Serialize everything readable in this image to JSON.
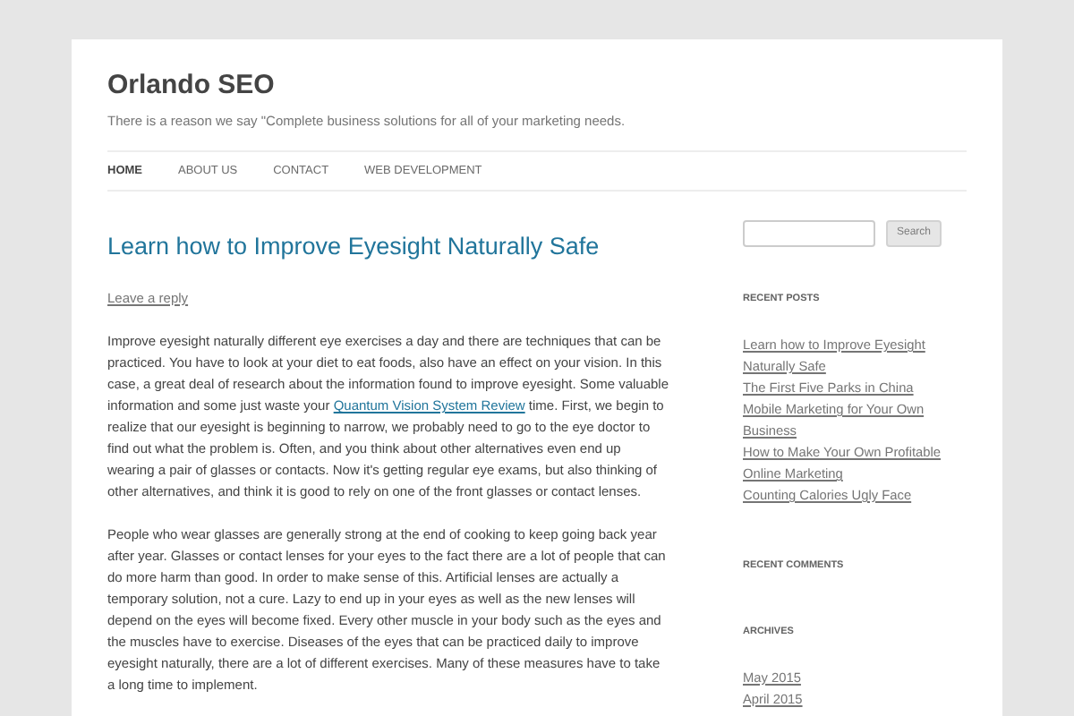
{
  "site": {
    "title": "Orlando SEO",
    "tagline": "There is a reason we say \"Complete business solutions for all of your marketing needs."
  },
  "nav": [
    {
      "label": "HOME",
      "selected": true
    },
    {
      "label": "ABOUT US",
      "selected": false
    },
    {
      "label": "CONTACT",
      "selected": false
    },
    {
      "label": "WEB DEVELOPMENT",
      "selected": false
    }
  ],
  "post": {
    "title": "Learn how to Improve Eyesight Naturally Safe",
    "reply_link": "Leave a reply",
    "paragraphs": [
      {
        "before": "Improve eyesight naturally different eye exercises a day and there are techniques that can be practiced. You have to look at your diet to eat foods, also have an effect on your vision. In this case, a great deal of research about the information found to improve eyesight. Some valuable information and some just waste your",
        "link": "Quantum Vision System Review",
        "after": "time. First, we begin to realize that our eyesight is beginning to narrow, we probably need to go to the eye doctor to find out what the problem is. Often, and you think about other alternatives even end up wearing a pair of glasses or contacts. Now it's getting regular eye exams, but also thinking of other alternatives, and think it is good to rely on one of the front glasses or contact lenses."
      },
      {
        "before": "People who wear glasses are generally strong at the end of cooking to keep going back year after year. Glasses or contact lenses for your eyes to the fact there are a lot of people that can do more harm than good. In order to make sense of this. Artificial lenses are actually a temporary solution, not a cure. Lazy to end up in your eyes as well as the new lenses will depend on the eyes will become fixed. Every other muscle in your body such as the eyes and the muscles have to exercise. Diseases of the eyes that can be practiced daily to improve eyesight naturally, there are a lot of different exercises. Many of these measures have to take a long time to implement."
      }
    ]
  },
  "sidebar": {
    "search_button": "Search",
    "widgets": [
      {
        "heading": "RECENT POSTS",
        "links": [
          "Learn how to Improve Eyesight Naturally Safe",
          "The First Five Parks in China",
          "Mobile Marketing for Your Own Business",
          "How to Make Your Own Profitable Online Marketing",
          "Counting Calories Ugly Face"
        ]
      },
      {
        "heading": "RECENT COMMENTS"
      },
      {
        "heading": "ARCHIVES",
        "links": [
          "May 2015",
          "April 2015"
        ]
      }
    ]
  }
}
